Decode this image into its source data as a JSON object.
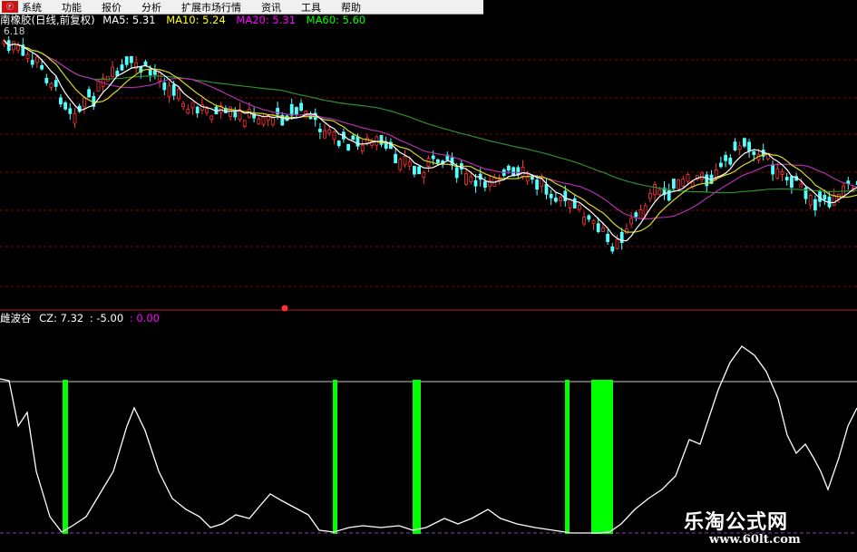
{
  "app": {
    "logo": "Ⓕ"
  },
  "menu": [
    "系统",
    "功能",
    "报价",
    "分析",
    "扩展市场行情",
    "资讯",
    "工具",
    "帮助"
  ],
  "main_panel": {
    "name": "南橡胶(日线,前复权)",
    "ma": [
      {
        "label": "MA5: 5.31",
        "color": "#ffffff"
      },
      {
        "label": "MA10: 5.24",
        "color": "#ffff00"
      },
      {
        "label": "MA20: 5.31",
        "color": "#ff00ff"
      },
      {
        "label": "MA60: 5.60",
        "color": "#00ff00"
      }
    ],
    "high_label": "6.18"
  },
  "indicator_panel": {
    "name": "雌波谷",
    "cz_label": "CZ: 7.32",
    "values": [
      {
        "text": ": -5.00",
        "color": "#ffffff"
      },
      {
        "text": ": 0.00",
        "color": "#ff00ff"
      }
    ]
  },
  "watermark": {
    "site": "乐淘公式网",
    "url": "www.60lt.com"
  },
  "colors": {
    "up": "#ff3232",
    "down": "#54ffff",
    "bar": "#00ff00",
    "dash": "#8a0000"
  }
}
